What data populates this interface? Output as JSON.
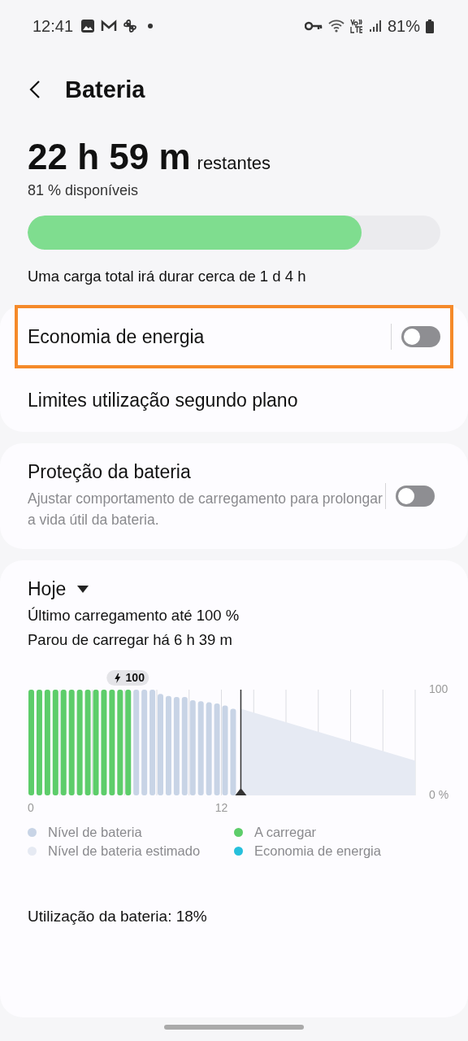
{
  "status_bar": {
    "time": "12:41",
    "battery": "81%"
  },
  "header": {
    "title": "Bateria"
  },
  "summary": {
    "time_left": "22 h 59 m",
    "suffix": "restantes",
    "available": "81 % disponíveis",
    "level": 0.81,
    "note": "Uma carga total irá durar cerca de 1 d 4 h"
  },
  "settings_card": {
    "rows": [
      {
        "kind": "toggle",
        "label": "Economia de energia",
        "on": false,
        "highlighted": true
      },
      {
        "kind": "link",
        "label": "Limites utilização segundo plano",
        "highlighted": false
      }
    ]
  },
  "protection_card": {
    "label": "Proteção da bateria",
    "description": "Ajustar comportamento de carregamento para prolongar a vida útil da bateria.",
    "on": false
  },
  "usage_card": {
    "period": "Hoje",
    "last_charge": "Último carregamento até 100 %",
    "stopped": "Parou de carregar há 6 h 39 m",
    "peak_label": "100",
    "chart_data": {
      "type": "bar",
      "x": [
        0,
        0.5,
        1,
        1.5,
        2,
        2.5,
        3,
        3.5,
        4,
        4.5,
        5,
        5.5,
        6,
        6.5,
        7,
        7.5,
        8,
        8.5,
        9,
        9.5,
        10,
        10.5,
        11,
        11.5,
        12,
        12.5
      ],
      "series": [
        {
          "name": "Nível de bateria",
          "color": "#c8d4e6",
          "values": [
            null,
            null,
            null,
            null,
            null,
            null,
            null,
            null,
            null,
            null,
            null,
            null,
            null,
            100,
            100,
            100,
            96,
            94,
            93,
            93,
            90,
            89,
            88,
            87,
            85,
            82
          ]
        },
        {
          "name": "A carregar",
          "color": "#5dcd6a",
          "values": [
            100,
            100,
            100,
            100,
            100,
            100,
            100,
            100,
            100,
            100,
            100,
            100,
            100,
            null,
            null,
            null,
            null,
            null,
            null,
            null,
            null,
            null,
            null,
            null,
            null,
            null
          ]
        }
      ],
      "xlim": [
        0,
        24
      ],
      "ylim": [
        0,
        100
      ],
      "xticks": [
        0,
        12
      ],
      "yticks": [
        {
          "value": 100,
          "label": "100"
        },
        {
          "value": 0,
          "label": "0 %"
        }
      ]
    },
    "legend": [
      {
        "label": "Nível de bateria estimado",
        "color": "#e6eaf3"
      },
      {
        "label": "Economia de energia",
        "color": "#26c0dc"
      }
    ],
    "usage": "Utilização da bateria: 18%"
  }
}
